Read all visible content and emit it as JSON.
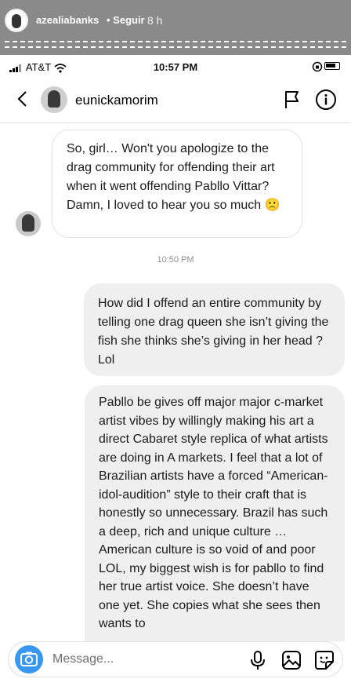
{
  "story": {
    "username": "azealiabanks",
    "follow_label": "• Seguir",
    "time": "8 h"
  },
  "status_bar": {
    "carrier": "AT&T",
    "time": "10:57 PM"
  },
  "header": {
    "name": "eunickamorim"
  },
  "messages": {
    "incoming_1": "So, girl… Won't you apologize to the drag community for offending their art when it went offending Pabllo Vittar? Damn, I loved to hear you so much 🙁",
    "timestamp": "10:50 PM",
    "outgoing_1": "How did I offend an entire community by telling one drag queen she isn’t giving the fish she thinks she’s giving in her head ? Lol",
    "outgoing_2": "Pabllo be gives off major major c-market artist vibes by willingly making his art a direct Cabaret style replica of what artists are doing in A markets. I feel that a lot of Brazilian artists have a forced “American-idol-audition” style to their craft that is honestly so unnecessary. Brazil has such a deep, rich and unique culture … American culture is so void of and poor LOL, my biggest wish is for pabllo to find her true artist voice. She doesn’t have one yet. She copies what she sees then wants to"
  },
  "composer": {
    "placeholder": "Message..."
  },
  "colors": {
    "accent": "#3897f0",
    "story_bar": "#8a8a8a",
    "bubble_out": "#efefef"
  }
}
